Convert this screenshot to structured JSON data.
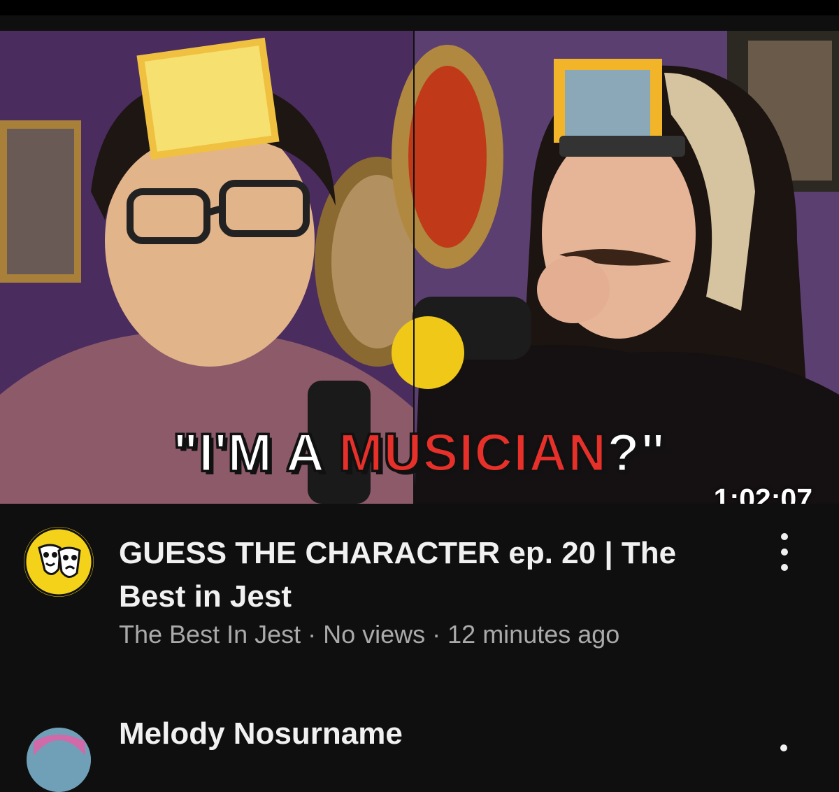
{
  "video": {
    "thumbnail": {
      "caption_prefix": "\"I'M A ",
      "caption_accent": "MUSICIAN",
      "caption_suffix": "?\"",
      "accent_color": "#e8302a"
    },
    "duration": "1:02:07",
    "channel_avatar_icon": "comedy-tragedy-masks-icon",
    "title": "GUESS THE CHARACTER ep. 20 | The Best in Jest",
    "meta": "The Best In Jest · No views · 12 minutes ago",
    "more_icon": "kebab-menu-icon"
  },
  "next_item": {
    "author": "Melody Nosurname",
    "more_icon": "kebab-menu-icon"
  }
}
